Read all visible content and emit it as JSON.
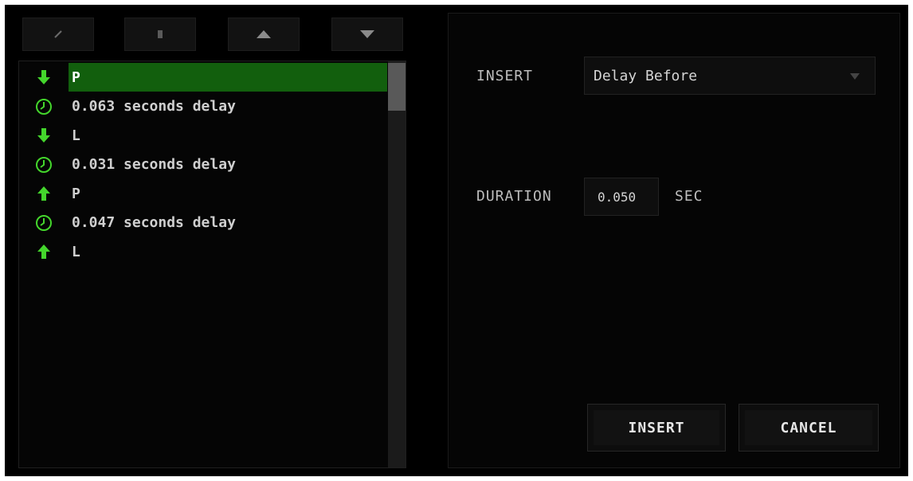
{
  "toolbar": {
    "buttons": [
      {
        "icon": "pencil-icon"
      },
      {
        "icon": "trash-icon"
      },
      {
        "icon": "arrow-up-icon"
      },
      {
        "icon": "arrow-down-icon"
      }
    ]
  },
  "macro_list": {
    "items": [
      {
        "type": "key-down",
        "icon": "arrow-down-icon",
        "label": "P",
        "selected": true
      },
      {
        "type": "delay",
        "icon": "clock-icon",
        "label": "0.063 seconds delay",
        "selected": false
      },
      {
        "type": "key-down",
        "icon": "arrow-down-icon",
        "label": "L",
        "selected": false
      },
      {
        "type": "delay",
        "icon": "clock-icon",
        "label": "0.031 seconds delay",
        "selected": false
      },
      {
        "type": "key-up",
        "icon": "arrow-up-icon",
        "label": "P",
        "selected": false
      },
      {
        "type": "delay",
        "icon": "clock-icon",
        "label": "0.047 seconds delay",
        "selected": false
      },
      {
        "type": "key-up",
        "icon": "arrow-up-icon",
        "label": "L",
        "selected": false
      }
    ]
  },
  "settings": {
    "insert_label": "INSERT",
    "insert_value": "Delay Before",
    "duration_label": "DURATION",
    "duration_value": "0.050",
    "duration_unit": "SEC"
  },
  "actions": {
    "insert_label": "INSERT",
    "cancel_label": "CANCEL"
  },
  "colors": {
    "accent": "#44d62c",
    "selected_row": "#125f0d",
    "background": "#000000"
  }
}
